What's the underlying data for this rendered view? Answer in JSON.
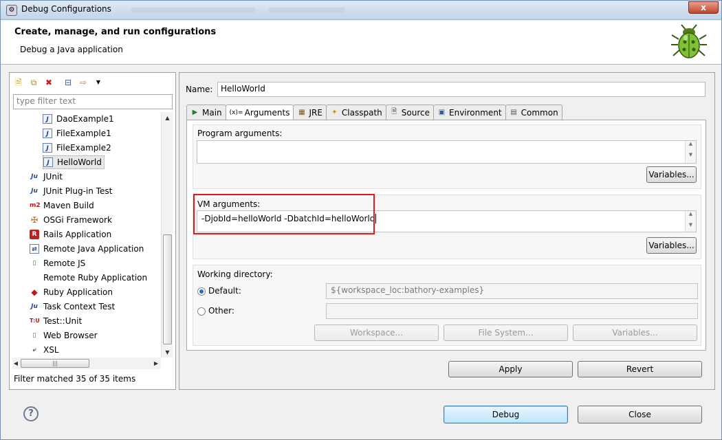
{
  "window": {
    "title": "Debug Configurations",
    "close_glyph": "x"
  },
  "header": {
    "title": "Create, manage, and run configurations",
    "subtitle": "Debug a Java application",
    "icon": "bug-icon"
  },
  "left_panel": {
    "toolbar_icons": [
      "new-config-icon",
      "duplicate-icon",
      "delete-icon",
      "collapse-all-icon",
      "filter-icon",
      "dropdown-icon"
    ],
    "filter_placeholder": "type filter text",
    "tree": [
      {
        "label": "DaoExample1",
        "icon": "java-class-icon",
        "indent": 1
      },
      {
        "label": "FileExample1",
        "icon": "java-class-icon",
        "indent": 1
      },
      {
        "label": "FileExample2",
        "icon": "java-class-icon",
        "indent": 1
      },
      {
        "label": "HelloWorld",
        "icon": "java-class-icon",
        "indent": 1,
        "selected": true
      },
      {
        "label": "JUnit",
        "icon": "junit-icon",
        "indent": 0
      },
      {
        "label": "JUnit Plug-in Test",
        "icon": "junit-plugin-icon",
        "indent": 0
      },
      {
        "label": "Maven Build",
        "icon": "maven-icon",
        "indent": 0
      },
      {
        "label": "OSGi Framework",
        "icon": "osgi-icon",
        "indent": 0
      },
      {
        "label": "Rails Application",
        "icon": "rails-icon",
        "indent": 0
      },
      {
        "label": "Remote Java Application",
        "icon": "remote-java-icon",
        "indent": 0
      },
      {
        "label": "Remote JS",
        "icon": "remote-js-icon",
        "indent": 0
      },
      {
        "label": "Remote Ruby Application",
        "icon": "",
        "indent": 0
      },
      {
        "label": "Ruby Application",
        "icon": "ruby-icon",
        "indent": 0
      },
      {
        "label": "Task Context Test",
        "icon": "task-context-icon",
        "indent": 0
      },
      {
        "label": "Test::Unit",
        "icon": "test-unit-icon",
        "indent": 0
      },
      {
        "label": "Web Browser",
        "icon": "web-browser-icon",
        "indent": 0
      },
      {
        "label": "XSL",
        "icon": "xsl-icon",
        "indent": 0
      }
    ],
    "status": "Filter matched 35 of 35 items"
  },
  "right_panel": {
    "name_label": "Name:",
    "name_value": "HelloWorld",
    "tabs": [
      {
        "label": "Main",
        "icon": "main-tab-icon",
        "active": false
      },
      {
        "label": "Arguments",
        "icon": "arguments-tab-icon",
        "active": true
      },
      {
        "label": "JRE",
        "icon": "jre-tab-icon",
        "active": false
      },
      {
        "label": "Classpath",
        "icon": "classpath-tab-icon",
        "active": false
      },
      {
        "label": "Source",
        "icon": "source-tab-icon",
        "active": false
      },
      {
        "label": "Environment",
        "icon": "environment-tab-icon",
        "active": false
      },
      {
        "label": "Common",
        "icon": "common-tab-icon",
        "active": false
      }
    ],
    "program_args": {
      "label": "Program arguments:",
      "value": "",
      "variables_button": "Variables..."
    },
    "vm_args": {
      "label": "VM arguments:",
      "value": "-DjobId=helloWorld -DbatchId=helloWorld",
      "variables_button": "Variables..."
    },
    "working_directory": {
      "label": "Working directory:",
      "default_label": "Default:",
      "default_value": "${workspace_loc:bathory-examples}",
      "other_label": "Other:",
      "other_value": "",
      "selected": "default",
      "buttons": [
        "Workspace...",
        "File System...",
        "Variables..."
      ]
    },
    "apply_button": "Apply",
    "revert_button": "Revert"
  },
  "footer": {
    "help_glyph": "?",
    "debug_button": "Debug",
    "close_button": "Close"
  },
  "colors": {
    "highlight_box": "#e0191b",
    "window_bg": "#f0f0f0"
  }
}
